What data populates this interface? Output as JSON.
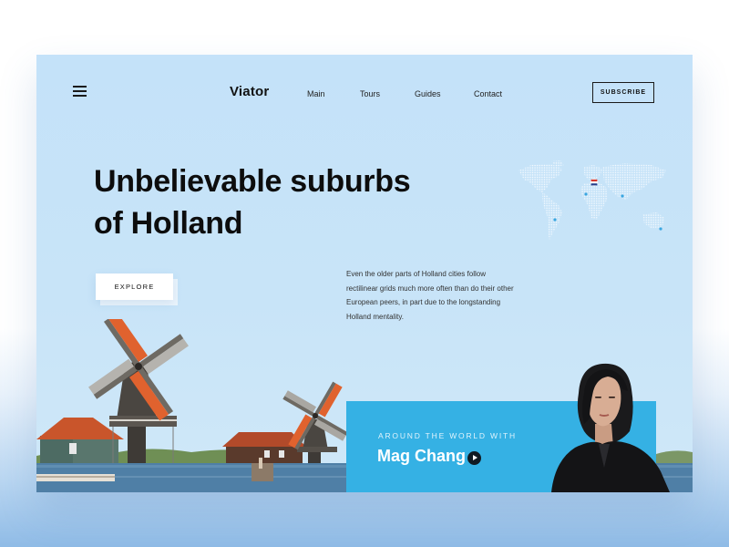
{
  "header": {
    "logo": "Viator",
    "nav": [
      "Main",
      "Tours",
      "Guides",
      "Contact"
    ],
    "subscribe_label": "SUBSCRIBE"
  },
  "hero": {
    "title_line1": "Unbelievable suburbs",
    "title_line2": "of Holland",
    "explore_label": "EXPLORE",
    "description": "Even the older parts of Holland cities follow rectilinear grids much more often than do their other European peers, in part due to the longstanding Holland mentality."
  },
  "promo": {
    "eyebrow": "AROUND THE WORLD WITH",
    "name": "Mag Chang"
  },
  "colors": {
    "background": "#c4e2f9",
    "accent": "#35b1e4",
    "text": "#0d0d0d",
    "windmill_sail": "#e0622e",
    "roof": "#c9552b"
  },
  "icons": [
    "hamburger-menu-icon",
    "play-icon",
    "netherlands-flag-icon",
    "world-map"
  ]
}
